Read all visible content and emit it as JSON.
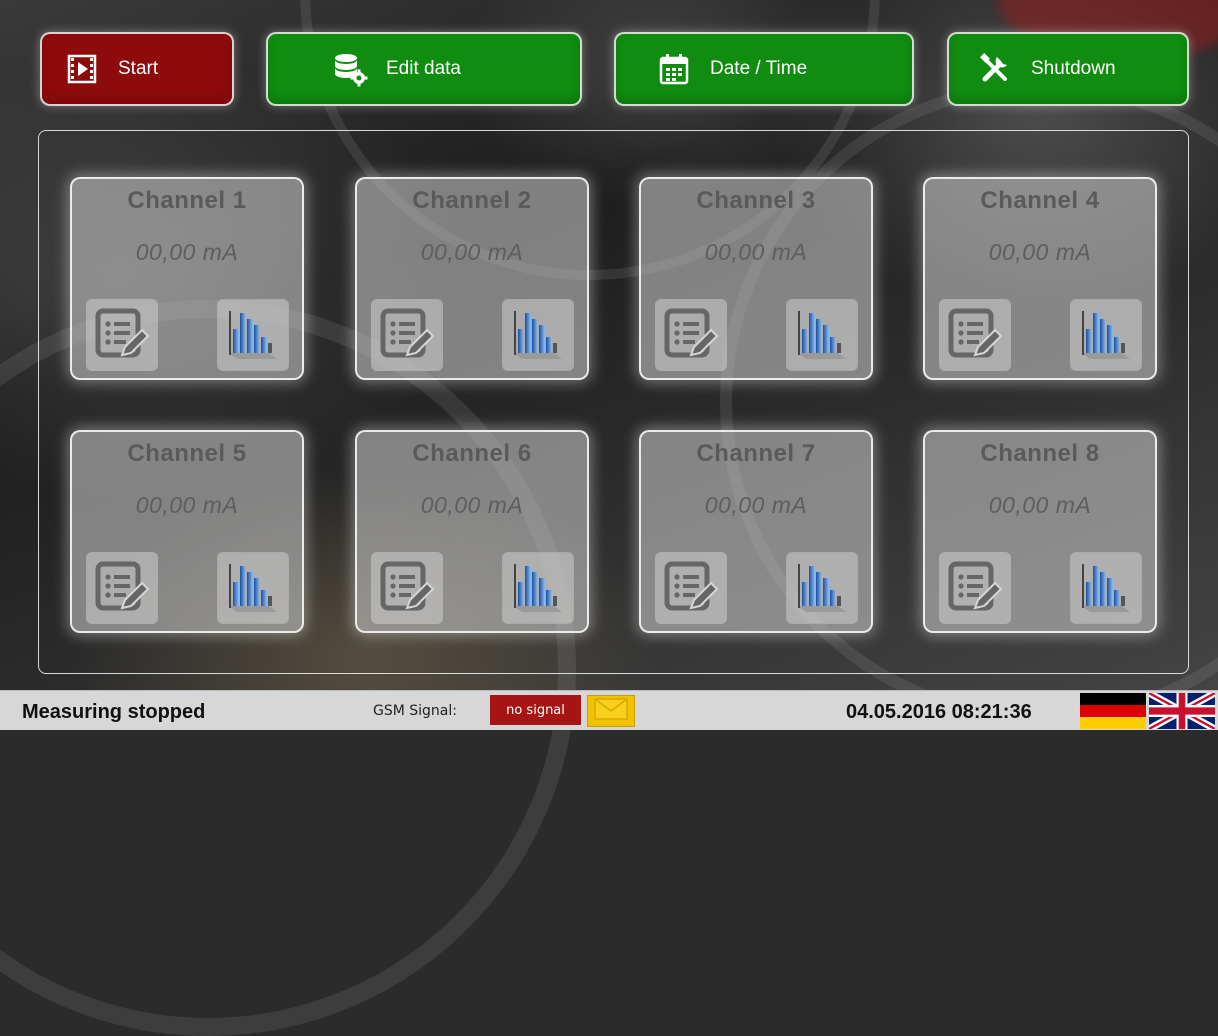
{
  "toolbar": {
    "start_label": "Start",
    "edit_label": "Edit data",
    "date_label": "Date / Time",
    "shutdown_label": "Shutdown",
    "colors": {
      "start": "#8e0b0b",
      "action": "#108d10"
    }
  },
  "channels": [
    {
      "name": "Channel 1",
      "value": "00,00 mA"
    },
    {
      "name": "Channel 2",
      "value": "00,00 mA"
    },
    {
      "name": "Channel 3",
      "value": "00,00 mA"
    },
    {
      "name": "Channel 4",
      "value": "00,00 mA"
    },
    {
      "name": "Channel 5",
      "value": "00,00 mA"
    },
    {
      "name": "Channel 6",
      "value": "00,00 mA"
    },
    {
      "name": "Channel 7",
      "value": "00,00 mA"
    },
    {
      "name": "Channel 8",
      "value": "00,00 mA"
    }
  ],
  "channel_icons": {
    "edit": "list-edit-icon",
    "chart": "bar-chart-icon"
  },
  "status": {
    "measuring": "Measuring stopped",
    "gsm_label": "GSM Signal:",
    "gsm_value": "no signal",
    "gsm_color": "#a61414",
    "mail_icon": "envelope-icon",
    "datetime": "04.05.2016 08:21:36",
    "languages": [
      "german-flag-icon",
      "uk-flag-icon"
    ]
  }
}
